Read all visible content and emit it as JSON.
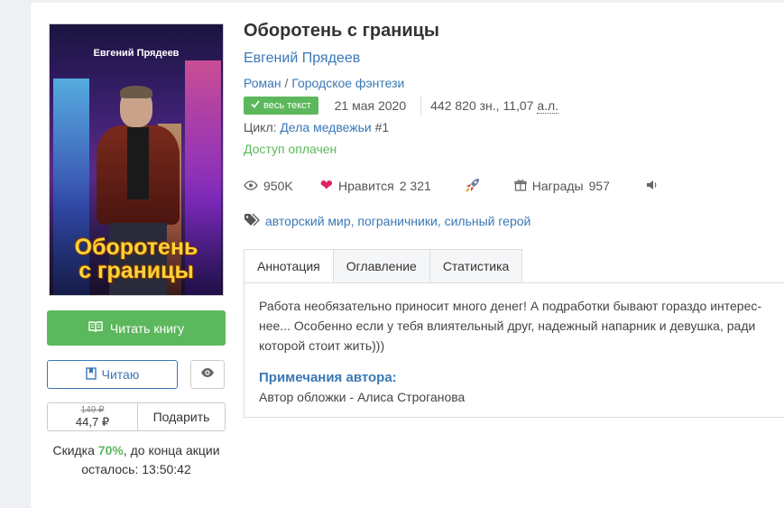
{
  "book": {
    "cover_author": "Евгений Прядеев",
    "cover_title_line1": "Оборотень",
    "cover_title_line2": "с границы",
    "title": "Оборотень с границы",
    "author": "Евгений Прядеев",
    "genre1": "Роман",
    "genre_sep": " / ",
    "genre2": "Городское фэнтези",
    "badge": "весь текст",
    "date": "21 мая 2020",
    "size_prefix": "442 820 зн., 11,07 ",
    "size_unit": "а.л.",
    "cycle_label": "Цикл: ",
    "cycle_name": "Дела медвежьи",
    "cycle_num": " #1",
    "paid": "Доступ оплачен"
  },
  "stats": {
    "views": "950K",
    "likes_label": "Нравится",
    "likes": "2 321",
    "awards_label": "Награды",
    "awards": "957"
  },
  "tags": "авторский мир, пограничники, сильный герой",
  "actions": {
    "read": "Читать книгу",
    "reading": "Читаю",
    "old_price": "149 ₽",
    "new_price": "44,7 ₽",
    "gift": "Подарить",
    "discount_prefix": "Скидка ",
    "discount_pct": "70%",
    "discount_suffix": ", до конца акции",
    "discount_time": "осталось: 13:50:42"
  },
  "tabs": [
    "Аннотация",
    "Оглавление",
    "Статистика"
  ],
  "annotation": {
    "text": "Работа необязательно приносит много денег! А подработки бывают гораздо интерес-нее... Особенно если у тебя влиятельный друг, надежный напарник и девушка, ради которой стоит жить)))",
    "notes_title": "Примечания автора:",
    "notes_text": "Автор обложки - Алиса Строганова"
  },
  "colors": {
    "accent": "#3a78b5",
    "green": "#5cb85c",
    "heart": "#e0245e"
  }
}
